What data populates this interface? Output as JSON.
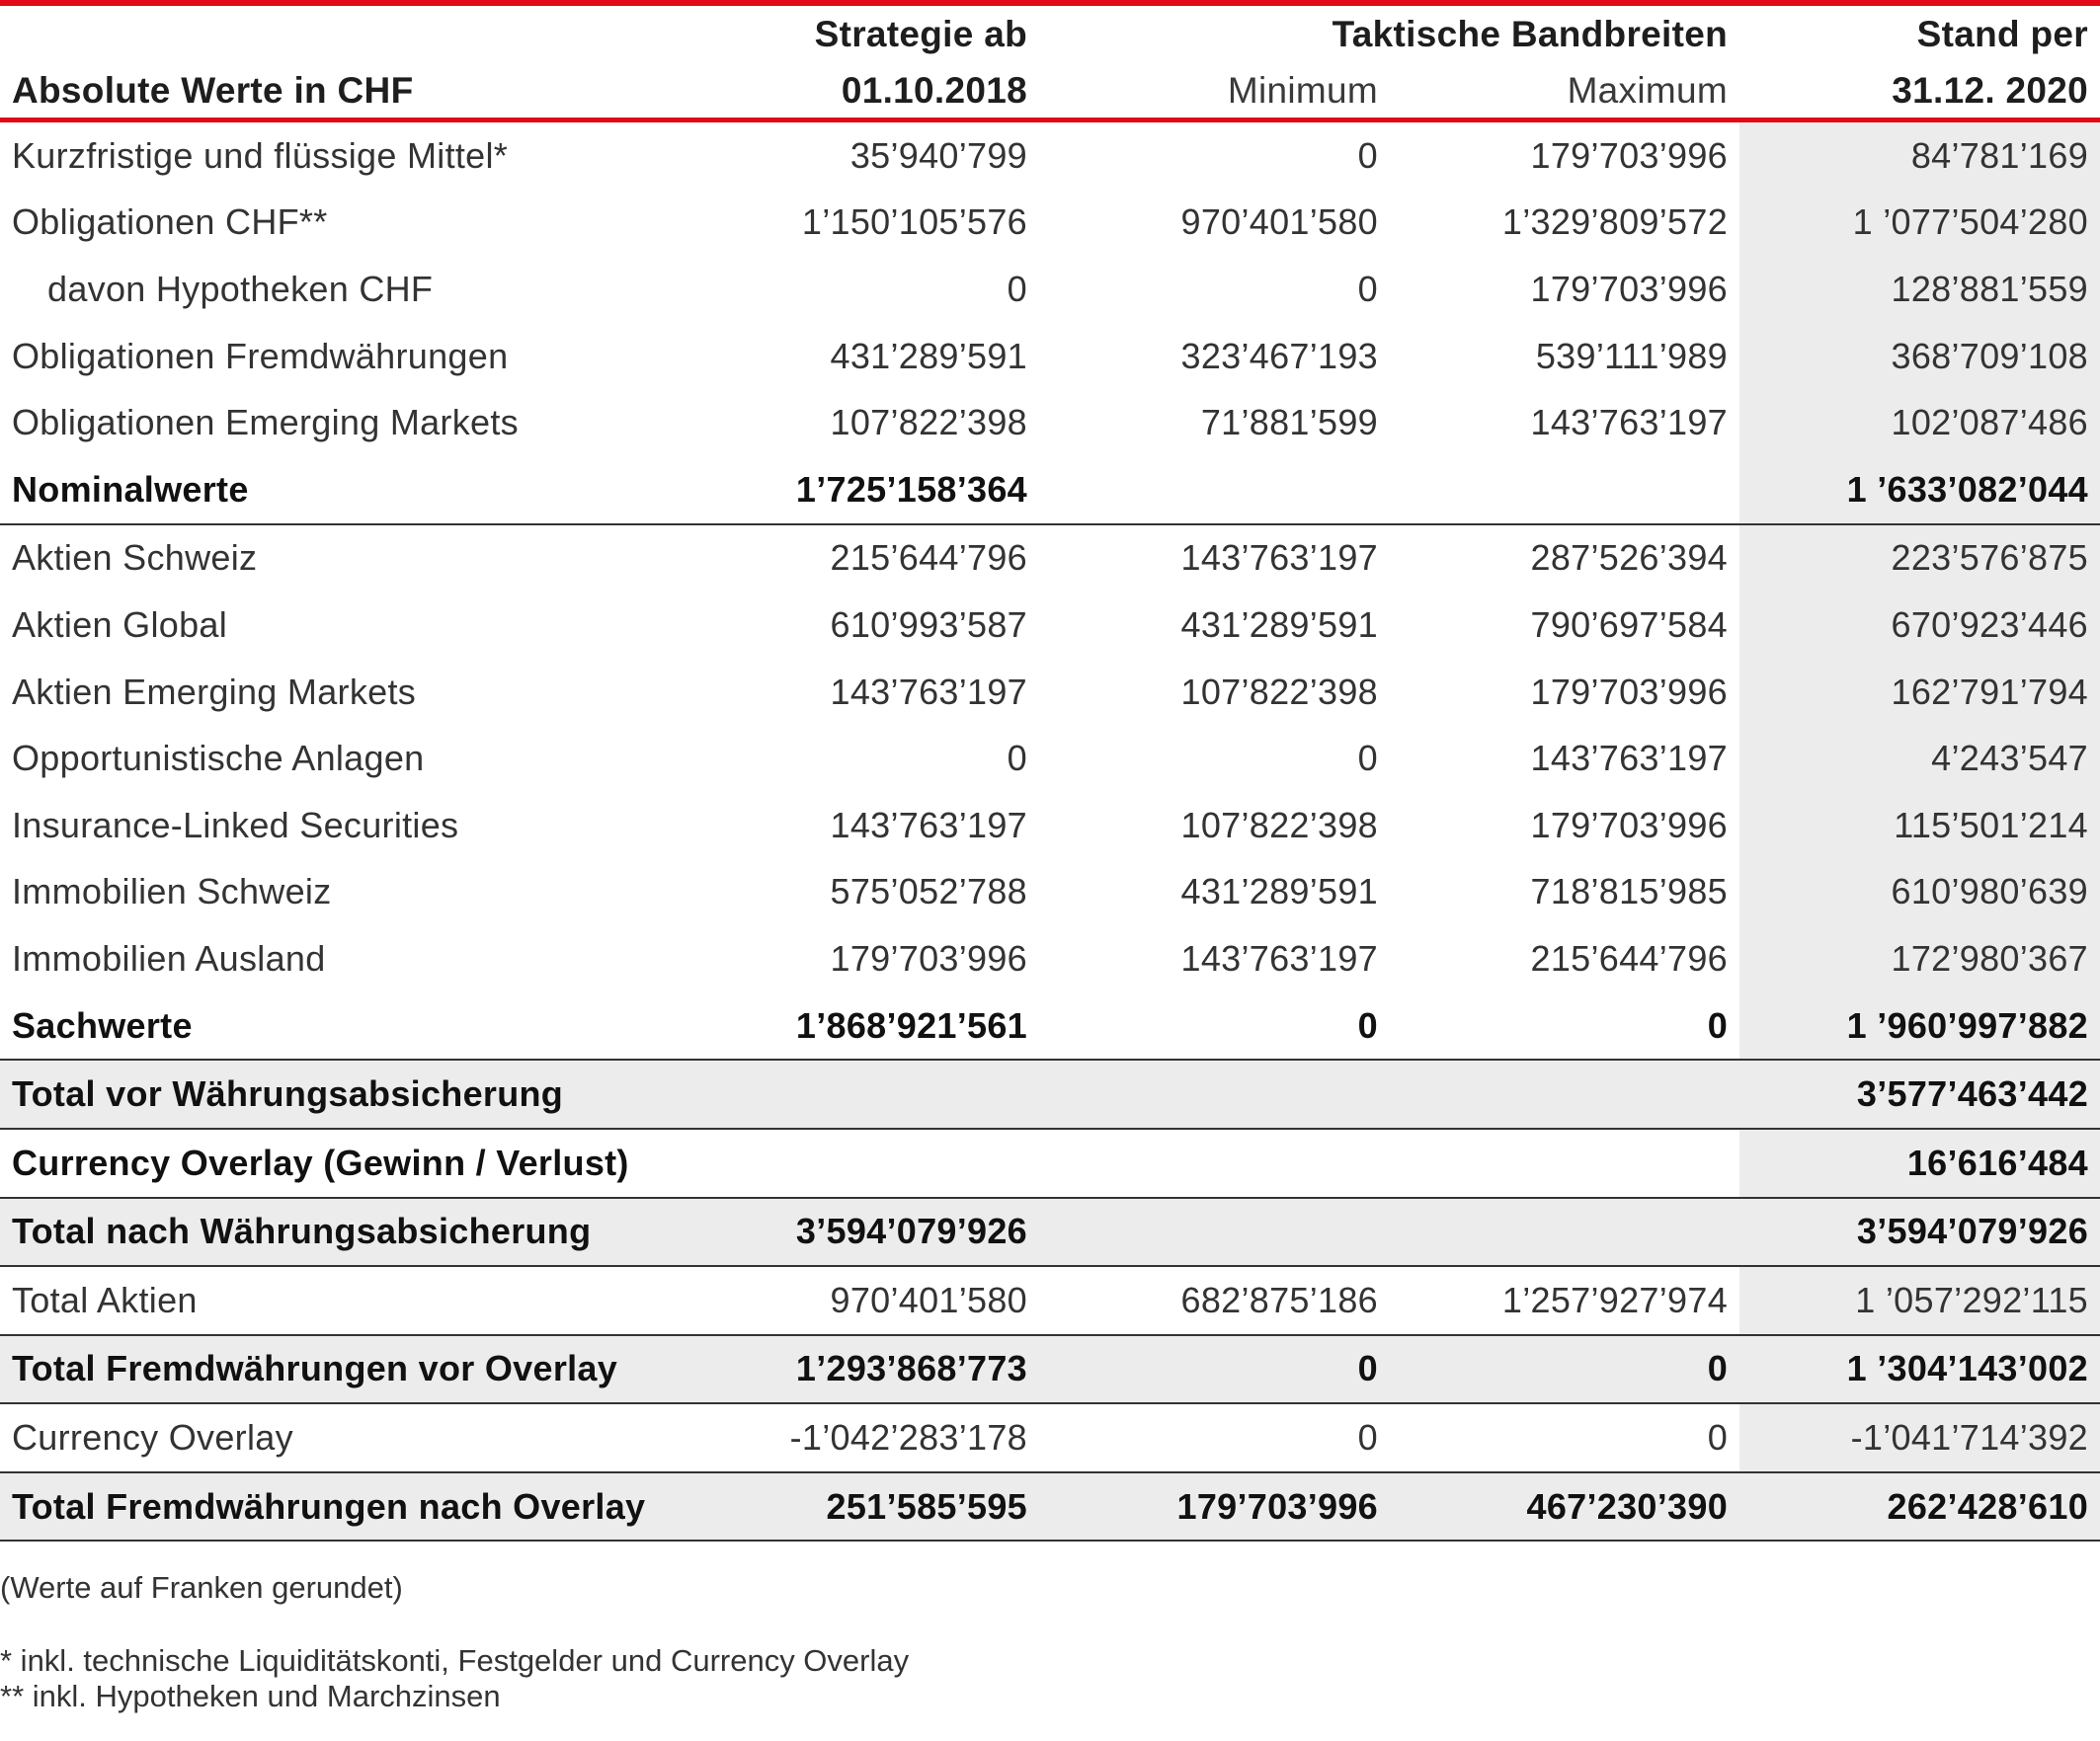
{
  "header": {
    "col0": "Absolute Werte in CHF",
    "col1_line1": "Strategie ab",
    "col1_line2": "01.10.2018",
    "bands_title": "Taktische Bandbreiten",
    "min_label": "Minimum",
    "max_label": "Maximum",
    "col4_line1": "Stand per",
    "col4_line2": "31.12. 2020"
  },
  "rows": [
    {
      "label": "Kurzfristige und flüssige Mittel*",
      "strategie": "35’940’799",
      "min": "0",
      "max": "179’703’996",
      "stand": "84’781’169"
    },
    {
      "label": "Obligationen CHF**",
      "strategie": "1’150’105’576",
      "min": "970’401’580",
      "max": "1’329’809’572",
      "stand": "1 ’077’504’280"
    },
    {
      "label": "davon Hypotheken CHF",
      "strategie": "0",
      "min": "0",
      "max": "179’703’996",
      "stand": "128’881’559"
    },
    {
      "label": "Obligationen Fremdwährungen",
      "strategie": "431’289’591",
      "min": "323’467’193",
      "max": "539’111’989",
      "stand": "368’709’108"
    },
    {
      "label": "Obligationen Emerging Markets",
      "strategie": "107’822’398",
      "min": "71’881’599",
      "max": "143’763’197",
      "stand": "102’087’486"
    },
    {
      "label": "Nominalwerte",
      "strategie": "1’725’158’364",
      "min": "",
      "max": "",
      "stand": "1 ’633’082’044"
    },
    {
      "label": "Aktien Schweiz",
      "strategie": "215’644’796",
      "min": "143’763’197",
      "max": "287’526’394",
      "stand": "223’576’875"
    },
    {
      "label": "Aktien Global",
      "strategie": "610’993’587",
      "min": "431’289’591",
      "max": "790’697’584",
      "stand": "670’923’446"
    },
    {
      "label": "Aktien Emerging Markets",
      "strategie": "143’763’197",
      "min": "107’822’398",
      "max": "179’703’996",
      "stand": "162’791’794"
    },
    {
      "label": "Opportunistische Anlagen",
      "strategie": "0",
      "min": "0",
      "max": "143’763’197",
      "stand": "4’243’547"
    },
    {
      "label": "Insurance-Linked Securities",
      "strategie": "143’763’197",
      "min": "107’822’398",
      "max": "179’703’996",
      "stand": "115’501’214"
    },
    {
      "label": "Immobilien Schweiz",
      "strategie": "575’052’788",
      "min": "431’289’591",
      "max": "718’815’985",
      "stand": "610’980’639"
    },
    {
      "label": "Immobilien Ausland",
      "strategie": "179’703’996",
      "min": "143’763’197",
      "max": "215’644’796",
      "stand": "172’980’367"
    },
    {
      "label": "Sachwerte",
      "strategie": "1’868’921’561",
      "min": "0",
      "max": "0",
      "stand": "1 ’960’997’882"
    },
    {
      "label": "Total vor Währungsabsicherung",
      "strategie": "",
      "min": "",
      "max": "",
      "stand": "3’577’463’442"
    },
    {
      "label": "Currency Overlay (Gewinn / Verlust)",
      "strategie": "",
      "min": "",
      "max": "",
      "stand": "16’616’484"
    },
    {
      "label": "Total nach Währungsabsicherung",
      "strategie": "3’594’079’926",
      "min": "",
      "max": "",
      "stand": "3’594’079’926"
    },
    {
      "label": "Total Aktien",
      "strategie": "970’401’580",
      "min": "682’875’186",
      "max": "1’257’927’974",
      "stand": "1 ’057’292’115"
    },
    {
      "label": "Total Fremdwährungen vor Overlay",
      "strategie": "1’293’868’773",
      "min": "0",
      "max": "0",
      "stand": "1 ’304’143’002"
    },
    {
      "label": "Currency Overlay",
      "strategie": "-1’042’283’178",
      "min": "0",
      "max": "0",
      "stand": "-1’041’714’392"
    },
    {
      "label": "Total Fremdwährungen nach Overlay",
      "strategie": "251’585’595",
      "min": "179’703’996",
      "max": "467’230’390",
      "stand": "262’428’610"
    }
  ],
  "notes": {
    "rounding": "(Werte auf Franken gerundet)",
    "footnote1": "* inkl. technische Liquiditätskonti, Festgelder und Currency Overlay",
    "footnote2": "** inkl. Hypotheken und Marchzinsen"
  },
  "colors": {
    "accent_red": "#e10918",
    "shade_gray": "#ececec"
  }
}
